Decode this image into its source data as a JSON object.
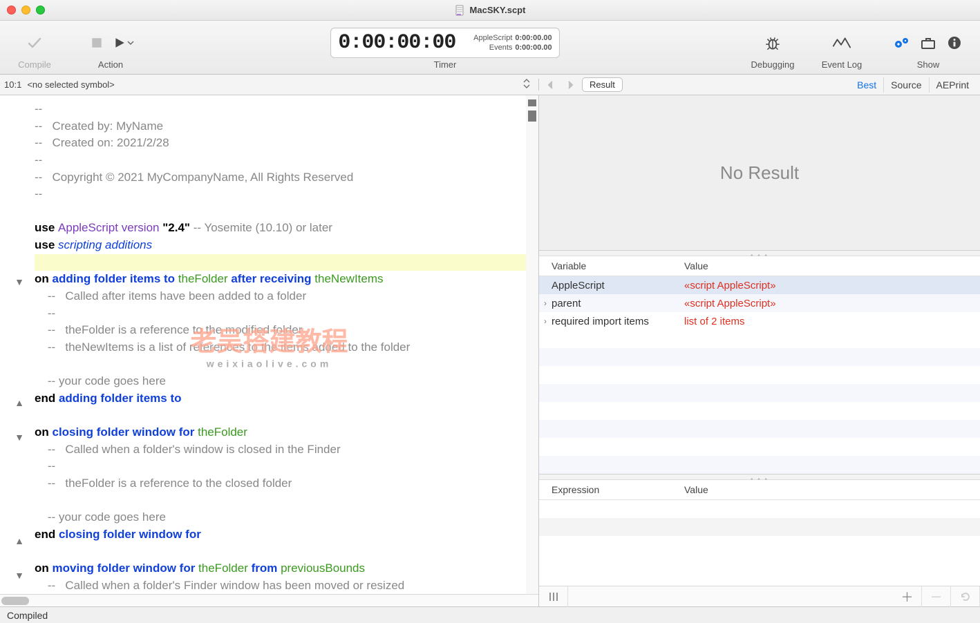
{
  "window": {
    "title": "MacSKY.scpt"
  },
  "toolbar": {
    "compile_label": "Compile",
    "action_label": "Action",
    "timer_label": "Timer",
    "debugging_label": "Debugging",
    "event_log_label": "Event Log",
    "show_label": "Show",
    "timer_main": "0:00:00:00",
    "timer_rows": [
      {
        "label": "AppleScript",
        "value": "0:00:00.00"
      },
      {
        "label": "Events",
        "value": "0:00:00.00"
      }
    ]
  },
  "editor_nav": {
    "position": "10:1",
    "symbol": "<no selected symbol>"
  },
  "code_lines": [
    {
      "t": "cm",
      "txt": "--"
    },
    {
      "t": "cm",
      "txt": "--   Created by: MyName"
    },
    {
      "t": "cm",
      "txt": "--   Created on: 2021/2/28"
    },
    {
      "t": "cm",
      "txt": "--"
    },
    {
      "t": "cm",
      "txt": "--   Copyright © 2021 MyCompanyName, All Rights Reserved"
    },
    {
      "t": "cm",
      "txt": "--"
    },
    {
      "t": "blank",
      "txt": ""
    },
    {
      "t": "use1",
      "parts": [
        "use ",
        "AppleScript",
        " version ",
        "\"2.4\"",
        " -- Yosemite (10.10) or later"
      ]
    },
    {
      "t": "use2",
      "parts": [
        "use ",
        "scripting additions"
      ]
    },
    {
      "t": "hl",
      "txt": ""
    },
    {
      "t": "hdr_open",
      "arrow": "down",
      "parts": [
        "on ",
        "adding folder items to ",
        "theFolder ",
        "after receiving ",
        "theNewItems"
      ]
    },
    {
      "t": "cm",
      "txt": "    --   Called after items have been added to a folder"
    },
    {
      "t": "cm",
      "txt": "    --"
    },
    {
      "t": "cm",
      "txt": "    --   theFolder is a reference to the modified folder"
    },
    {
      "t": "cm",
      "txt": "    --   theNewItems is a list of references to the items added to the folder"
    },
    {
      "t": "blank",
      "txt": ""
    },
    {
      "t": "cm",
      "txt": "    -- your code goes here"
    },
    {
      "t": "hdr_close",
      "arrow": "up",
      "parts": [
        "end ",
        "adding folder items to"
      ]
    },
    {
      "t": "blank",
      "txt": ""
    },
    {
      "t": "hdr_open",
      "arrow": "down",
      "parts": [
        "on ",
        "closing folder window for ",
        "theFolder"
      ]
    },
    {
      "t": "cm",
      "txt": "    --   Called when a folder's window is closed in the Finder"
    },
    {
      "t": "cm",
      "txt": "    --"
    },
    {
      "t": "cm",
      "txt": "    --   theFolder is a reference to the closed folder"
    },
    {
      "t": "blank",
      "txt": ""
    },
    {
      "t": "cm",
      "txt": "    -- your code goes here"
    },
    {
      "t": "hdr_close",
      "arrow": "up",
      "parts": [
        "end ",
        "closing folder window for"
      ]
    },
    {
      "t": "blank",
      "txt": ""
    },
    {
      "t": "hdr_open",
      "arrow": "down",
      "parts": [
        "on ",
        "moving folder window for ",
        "theFolder ",
        "from ",
        "previousBounds"
      ]
    },
    {
      "t": "cm",
      "txt": "    --   Called when a folder's Finder window has been moved or resized"
    }
  ],
  "result_panel": {
    "buttons": {
      "result": "Result"
    },
    "tabs": [
      "Best",
      "Source",
      "AEPrint"
    ],
    "active_tab": 0,
    "empty_text": "No Result"
  },
  "variables_panel": {
    "header": {
      "name": "Variable",
      "value": "Value"
    },
    "rows": [
      {
        "name": "AppleScript",
        "value": "«script AppleScript»",
        "sel": true
      },
      {
        "name": "parent",
        "value": "«script AppleScript»",
        "disclose": true
      },
      {
        "name": "required import items",
        "value": "list of 2 items",
        "disclose": true
      }
    ]
  },
  "expressions_panel": {
    "header": {
      "name": "Expression",
      "value": "Value"
    }
  },
  "status": {
    "text": "Compiled"
  },
  "watermark": {
    "main": "老吴搭建教程",
    "sub": "weixiaolive.com"
  }
}
